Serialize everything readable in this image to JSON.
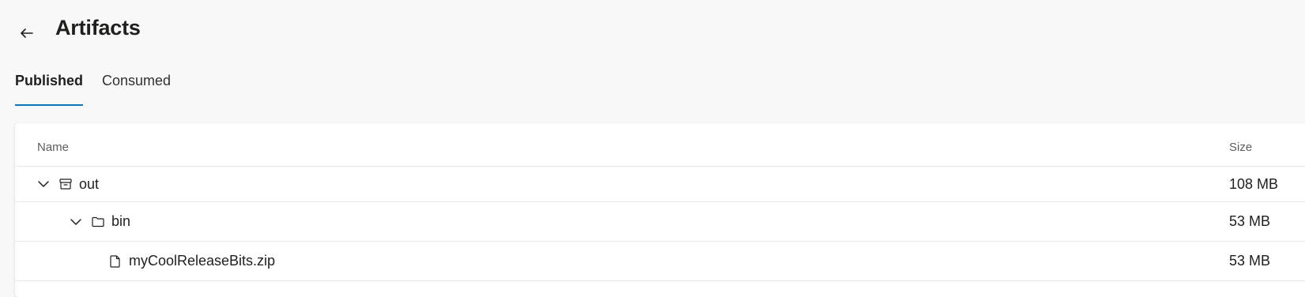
{
  "header": {
    "title": "Artifacts",
    "back_icon": "arrow-left-icon"
  },
  "tabs": [
    {
      "label": "Published",
      "active": true
    },
    {
      "label": "Consumed",
      "active": false
    }
  ],
  "table": {
    "columns": {
      "name": "Name",
      "size": "Size"
    },
    "rows": [
      {
        "name": "out",
        "size": "108 MB",
        "icon": "archive-icon",
        "expanded": true,
        "level": 0
      },
      {
        "name": "bin",
        "size": "53 MB",
        "icon": "folder-icon",
        "expanded": true,
        "level": 1
      },
      {
        "name": "myCoolReleaseBits.zip",
        "size": "53 MB",
        "icon": "file-icon",
        "expanded": null,
        "level": 2
      }
    ]
  },
  "colors": {
    "accent": "#0078d4",
    "background": "#f8f8f8",
    "card": "#ffffff"
  }
}
